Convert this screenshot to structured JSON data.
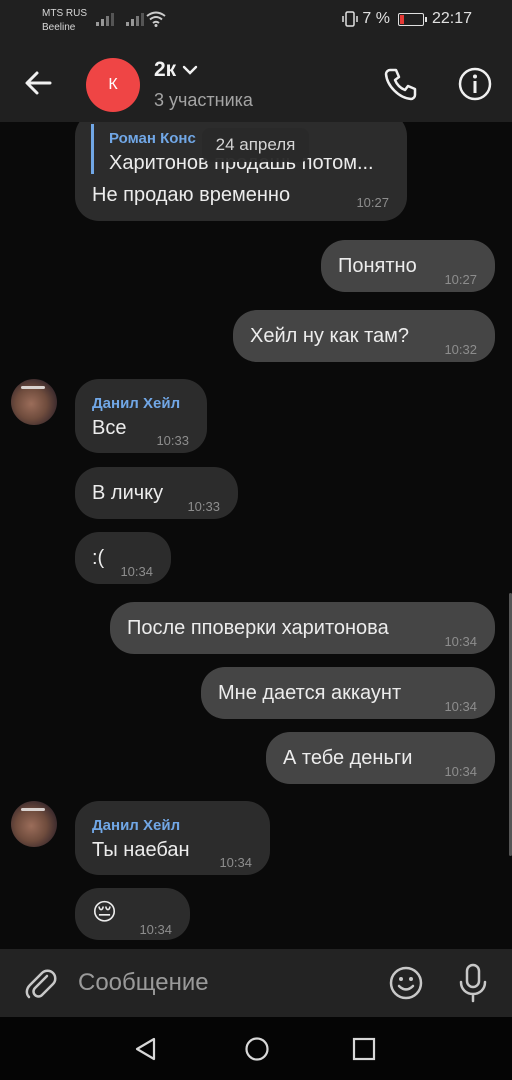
{
  "status_bar": {
    "carrier_line1": "MTS RUS",
    "carrier_line2": "Beeline",
    "battery_percent": "7 %",
    "time": "22:17",
    "battery_level": 0.07,
    "icons": [
      "signal-icon",
      "wifi-icon",
      "vibrate-icon",
      "battery-icon"
    ]
  },
  "header": {
    "avatar_letter": "К",
    "avatar_color": "#ef4545",
    "title": "2к",
    "subtitle": "3 участника",
    "icons": [
      "back-arrow-icon",
      "chevron-down-icon",
      "phone-icon",
      "info-icon"
    ]
  },
  "date_separator": "24 апреля",
  "messages": [
    {
      "direction": "in",
      "reply_to": {
        "name": "Роман Конс",
        "text": "Харитонов продашь потом..."
      },
      "text": "Не продаю временно",
      "time": "10:27"
    },
    {
      "direction": "out",
      "text": "Понятно",
      "time": "10:27"
    },
    {
      "direction": "out",
      "text": "Хейл ну как там?",
      "time": "10:32"
    },
    {
      "direction": "in",
      "sender": "Данил Хейл",
      "text": "Все",
      "time": "10:33"
    },
    {
      "direction": "in",
      "text": "В личку",
      "time": "10:33"
    },
    {
      "direction": "in",
      "text": ":(",
      "time": "10:34"
    },
    {
      "direction": "out",
      "text": "После пповерки харитонова",
      "time": "10:34"
    },
    {
      "direction": "out",
      "text": "Мне дается аккаунт",
      "time": "10:34"
    },
    {
      "direction": "out",
      "text": "А тебе деньги",
      "time": "10:34"
    },
    {
      "direction": "in",
      "sender": "Данил Хейл",
      "text": "Ты наебан",
      "time": "10:34"
    },
    {
      "direction": "in",
      "text": "😔",
      "time": "10:34"
    }
  ],
  "input_bar": {
    "placeholder": "Сообщение",
    "icons": [
      "attach-icon",
      "emoji-icon",
      "microphone-icon"
    ]
  },
  "nav_bar": {
    "icons": [
      "nav-back-icon",
      "nav-home-icon",
      "nav-recent-icon"
    ]
  },
  "colors": {
    "incoming_bubble": "#2c2c2c",
    "outgoing_bubble": "#454545",
    "sender_name": "#71a7e6",
    "background": "#0a0a0a"
  }
}
